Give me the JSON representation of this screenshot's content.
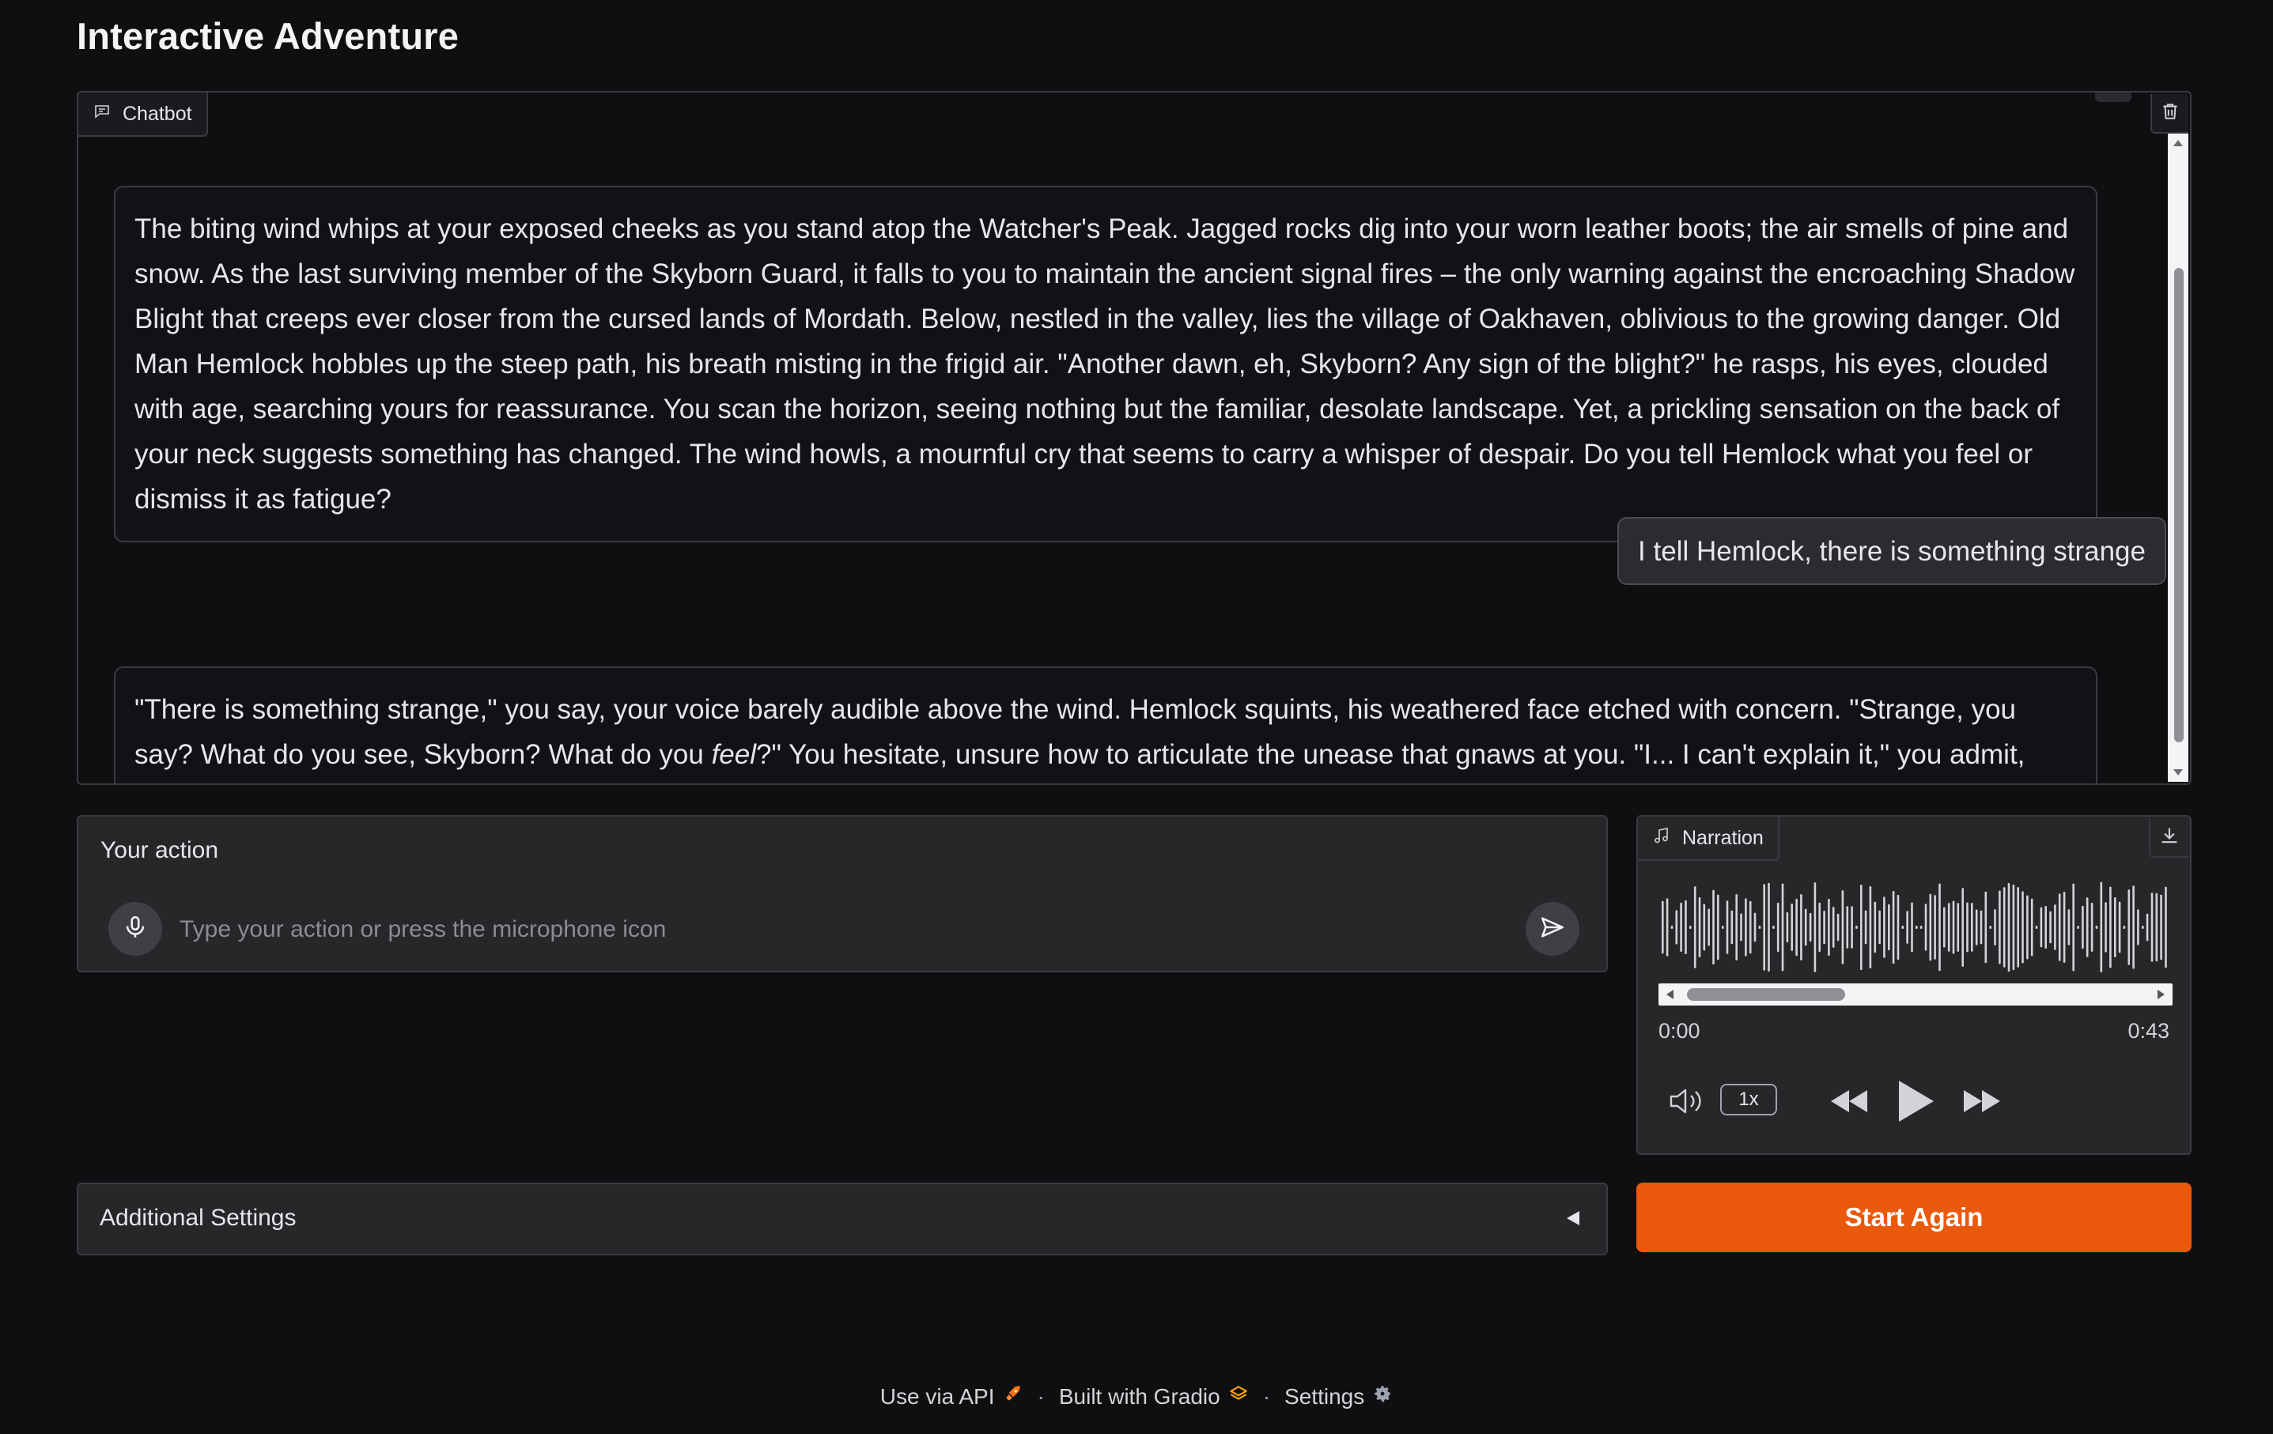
{
  "app": {
    "title": "Interactive Adventure"
  },
  "chatbot": {
    "label": "Chatbot",
    "messages": [
      {
        "role": "bot",
        "text": "The biting wind whips at your exposed cheeks as you stand atop the Watcher's Peak. Jagged rocks dig into your worn leather boots; the air smells of pine and snow. As the last surviving member of the Skyborn Guard, it falls to you to maintain the ancient signal fires – the only warning against the encroaching Shadow Blight that creeps ever closer from the cursed lands of Mordath. Below, nestled in the valley, lies the village of Oakhaven, oblivious to the growing danger. Old Man Hemlock hobbles up the steep path, his breath misting in the frigid air. \"Another dawn, eh, Skyborn? Any sign of the blight?\" he rasps, his eyes, clouded with age, searching yours for reassurance. You scan the horizon, seeing nothing but the familiar, desolate landscape. Yet, a prickling sensation on the back of your neck suggests something has changed. The wind howls, a mournful cry that seems to carry a whisper of despair. Do you tell Hemlock what you feel or dismiss it as fatigue?"
      },
      {
        "role": "user",
        "text": "I tell Hemlock, there is something strange"
      },
      {
        "role": "bot",
        "text_a": "\"There is something strange,\" you say, your voice barely audible above the wind. Hemlock squints, his weathered face etched with concern. \"Strange, you say? What do you see, Skyborn? What do you ",
        "text_em": "feel",
        "text_b": "?\" You hesitate, unsure how to articulate the unease that gnaws at you. \"I... I can't explain it,\" you admit, \"but there's a darkness in the air. A wrongness.\" Hemlock nods slowly, his gaze fixed on the horizon. \"The Blight stirs, then. I feared as much.\" He pauses, his eyes narrowing. \"We must warn the"
      }
    ]
  },
  "action": {
    "label": "Your action",
    "placeholder": "Type your action or press the microphone icon",
    "value": ""
  },
  "narration": {
    "label": "Narration",
    "time_start": "0:00",
    "time_end": "0:43",
    "speed": "1x"
  },
  "settings": {
    "label": "Additional Settings"
  },
  "start_button": {
    "label": "Start Again",
    "color": "#ea580c"
  },
  "footer": {
    "api": "Use via API",
    "built": "Built with Gradio",
    "settings": "Settings",
    "separator": "·"
  }
}
